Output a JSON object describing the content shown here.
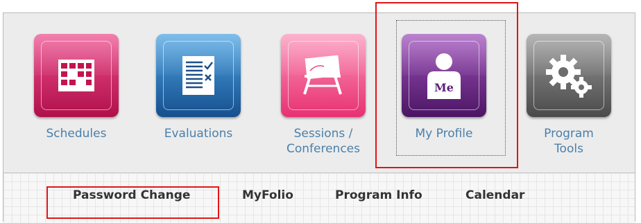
{
  "tiles": [
    {
      "label_lines": [
        "Schedules"
      ],
      "icon": "calendar-icon",
      "color": "#d61f62"
    },
    {
      "label_lines": [
        "Evaluations"
      ],
      "icon": "checklist-icon",
      "color": "#2a6fb3"
    },
    {
      "label_lines": [
        "Sessions /",
        "Conferences"
      ],
      "icon": "welcome-sign-icon",
      "color": "#f4578e"
    },
    {
      "label_lines": [
        "My Profile"
      ],
      "icon": "me-profile-icon",
      "icon_text": "Me",
      "color": "#6e2a8c"
    },
    {
      "label_lines": [
        "Program",
        "Tools"
      ],
      "icon": "gears-icon",
      "color": "#6e6e6e"
    }
  ],
  "nav": {
    "items": [
      "Password Change",
      "MyFolio",
      "Program Info",
      "Calendar"
    ]
  },
  "highlight_color": "#e31414"
}
